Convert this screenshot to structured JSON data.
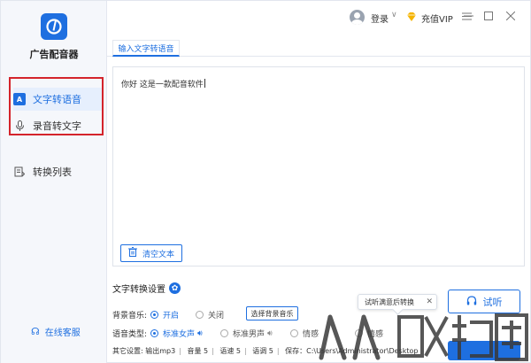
{
  "app": {
    "name": "广告配音器",
    "brand_color": "#1e6fe0",
    "highlight_color": "#d4242b"
  },
  "sidebar": {
    "items": [
      {
        "label": "文字转语音",
        "icon": "text-to-speech-icon",
        "active": true
      },
      {
        "label": "录音转文字",
        "icon": "microphone-icon",
        "active": false
      },
      {
        "label": "转换列表",
        "icon": "conversion-list-icon",
        "active": false
      }
    ],
    "service_label": "在线客服"
  },
  "topbar": {
    "login_label": "登录",
    "vip_label": "充值VIP"
  },
  "tabs": [
    {
      "label": "输入文字转语音",
      "active": true
    }
  ],
  "editor": {
    "text": "你好 这是一款配音软件",
    "clear_label": "清空文本"
  },
  "settings": {
    "title": "文字转换设置",
    "bgm": {
      "label": "背景音乐:",
      "options": [
        "开启",
        "关闭"
      ],
      "selected": "开启",
      "choose_button": "选择背景音乐"
    },
    "voice": {
      "label": "语音类型:",
      "options": [
        "标准女声",
        "标准男声",
        "情感",
        "情感"
      ],
      "selected": "标准女声"
    },
    "other": {
      "label": "其它设置:",
      "output": "输出mp3",
      "volume": "音量 5",
      "speed": "语速 5",
      "pitch": "语调 5",
      "save_path": "保存：C:\\Users\\Administrator\\Desktop"
    }
  },
  "tooltip": {
    "text": "试听满意后转换"
  },
  "actions": {
    "listen_label": "试听"
  },
  "watermark_text": "人人软件园"
}
